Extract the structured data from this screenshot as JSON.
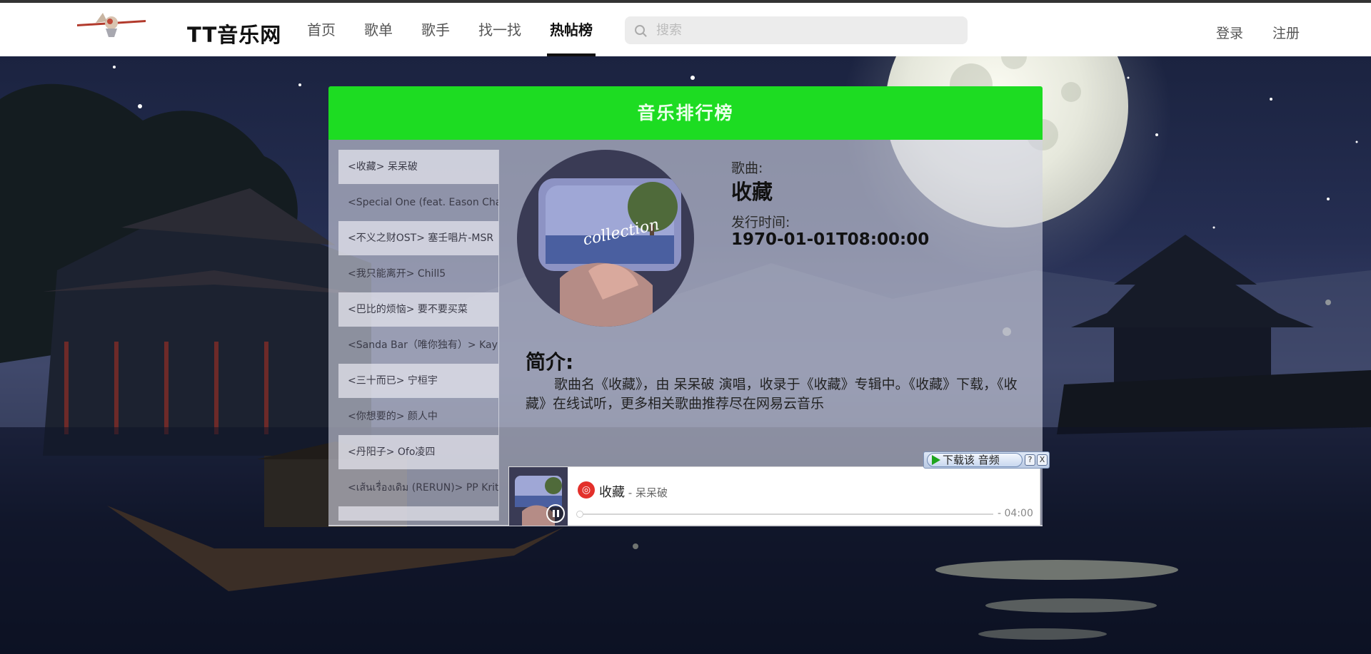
{
  "header": {
    "site_title": "TT音乐网",
    "nav": [
      "首页",
      "歌单",
      "歌手",
      "找一找",
      "热帖榜"
    ],
    "active_nav": "热帖榜",
    "search_placeholder": "搜索",
    "login": "登录",
    "register": "注册"
  },
  "card": {
    "title": "音乐排行榜",
    "songs": [
      "<收藏> 呆呆破",
      "<Special One (feat. Eason Chan",
      "<不义之财OST> 塞壬唱片-MSR",
      "<我只能离开> Chill5",
      "<巴比的烦恼> 要不要买菜",
      "<Sanda Bar（唯你独有）> Kay",
      "<三十而已> 宁桓宇",
      "<你想要的> 颜人中",
      "<丹阳子> Ofo凌四",
      "<เส้นเรื่องเดิม (RERUN)> PP Krit"
    ],
    "song_label": "歌曲:",
    "song_name": "收藏",
    "release_label": "发行时间:",
    "release_time": "1970-01-01T08:00:00",
    "cover_text": "collection",
    "intro_title": "简介:",
    "intro_text": "歌曲名《收藏》，由 呆呆破 演唱，收录于《收藏》专辑中。《收藏》下载，《收藏》在线试听，更多相关歌曲推荐尽在网易云音乐"
  },
  "player": {
    "song": "收藏",
    "artist": " - 呆呆破",
    "time": "- 04:00",
    "progress": 0,
    "state": "playing"
  },
  "download": {
    "label": "下载该 音频",
    "help": "?",
    "close": "X"
  },
  "colors": {
    "header_accent": "#1ddc22",
    "netease_red": "#e3302b"
  }
}
